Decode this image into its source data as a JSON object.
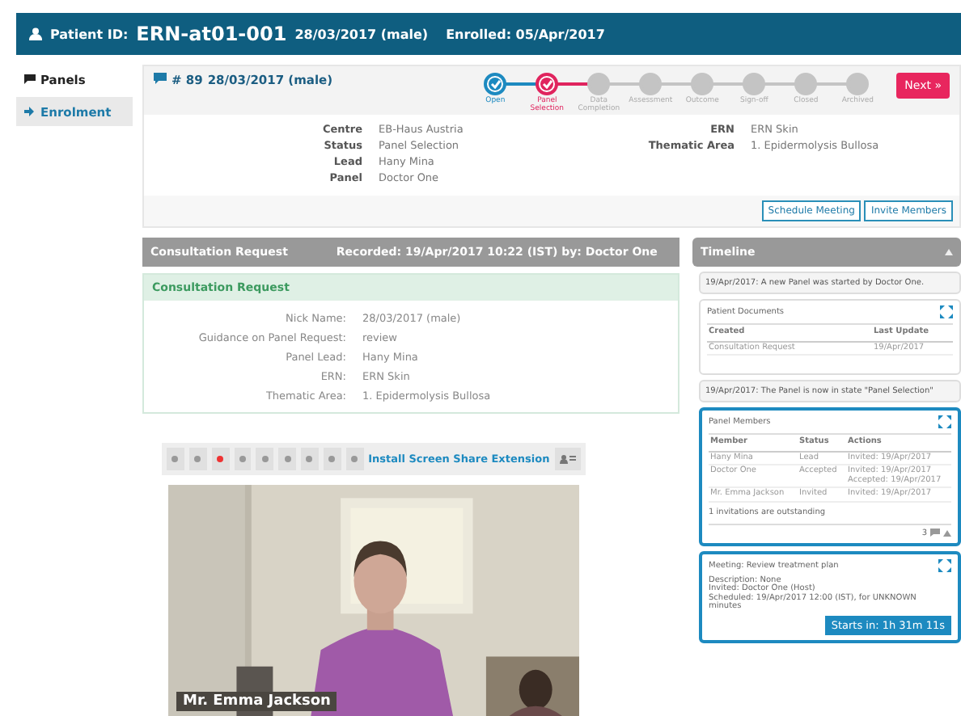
{
  "header": {
    "label": "Patient ID:",
    "patient_id": "ERN-at01-001",
    "nickname": "28/03/2017 (male)",
    "enrolled": "Enrolled: 05/Apr/2017"
  },
  "sidebar": {
    "items": [
      {
        "label": "Panels",
        "selected": true
      },
      {
        "label": "Enrolment",
        "selected": false
      }
    ]
  },
  "panel": {
    "number": "# 89",
    "title": "28/03/2017 (male)",
    "steps": [
      {
        "label": "Open",
        "kind": "done"
      },
      {
        "label": "Panel Selection",
        "kind": "current"
      },
      {
        "label": "Data Completion",
        "kind": "pending"
      },
      {
        "label": "Assessment",
        "kind": "pending"
      },
      {
        "label": "Outcome",
        "kind": "pending"
      },
      {
        "label": "Sign-off",
        "kind": "pending"
      },
      {
        "label": "Closed",
        "kind": "pending"
      },
      {
        "label": "Archived",
        "kind": "pending"
      }
    ],
    "next_button": "Next »",
    "details_left": [
      {
        "label": "Centre",
        "value": "EB-Haus Austria"
      },
      {
        "label": "Status",
        "value": "Panel Selection"
      },
      {
        "label": "Lead",
        "value": "Hany Mina"
      },
      {
        "label": "Panel",
        "value": "Doctor One"
      }
    ],
    "details_right": [
      {
        "label": "ERN",
        "value": "ERN Skin"
      },
      {
        "label": "Thematic Area",
        "value": "1. Epidermolysis Bullosa"
      }
    ],
    "buttons": [
      "Schedule Meeting",
      "Invite Members"
    ]
  },
  "consultation": {
    "title": "Consultation Request",
    "recorded": "Recorded: 19/Apr/2017 10:22 (IST) by: Doctor One",
    "card_title": "Consultation Request",
    "fields": [
      {
        "label": "Nick Name:",
        "value": "28/03/2017 (male)"
      },
      {
        "label": "Guidance on Panel Request:",
        "value": "review"
      },
      {
        "label": "Panel Lead:",
        "value": "Hany Mina"
      },
      {
        "label": "ERN:",
        "value": "ERN Skin"
      },
      {
        "label": "Thematic Area:",
        "value": "1. Epidermolysis Bullosa"
      }
    ]
  },
  "video": {
    "extension_link": "Install Screen Share Extension",
    "caller_name": "Mr. Emma Jackson",
    "kind": "picture"
  },
  "timeline": {
    "title": "Timeline",
    "events": [
      {
        "kind": "note",
        "text": "19/Apr/2017: A new Panel was started by Doctor One."
      },
      {
        "kind": "documents",
        "title": "Patient Documents",
        "columns": [
          "Created",
          "Last Update"
        ],
        "rows": [
          [
            "Consultation Request",
            "19/Apr/2017"
          ]
        ]
      },
      {
        "kind": "note",
        "text": "19/Apr/2017: The Panel is now in state \"Panel Selection\""
      },
      {
        "kind": "members",
        "title": "Panel Members",
        "columns": [
          "Member",
          "Status",
          "Actions"
        ],
        "rows": [
          [
            "Hany Mina",
            "Lead",
            "Invited: 19/Apr/2017"
          ],
          [
            "Doctor One",
            "Accepted",
            "Invited: 19/Apr/2017\nAccepted: 19/Apr/2017"
          ],
          [
            "Mr. Emma Jackson",
            "Invited",
            "Invited: 19/Apr/2017"
          ]
        ],
        "footnote": "1 invitations are outstanding",
        "count": "3"
      },
      {
        "kind": "meeting",
        "title": "Meeting: Review treatment plan",
        "lines": [
          "Description: None",
          "Invited: Doctor One (Host)",
          "Scheduled: 19/Apr/2017 12:00 (IST), for UNKNOWN minutes"
        ],
        "button": "Starts in: 1h 31m 11s"
      }
    ]
  }
}
